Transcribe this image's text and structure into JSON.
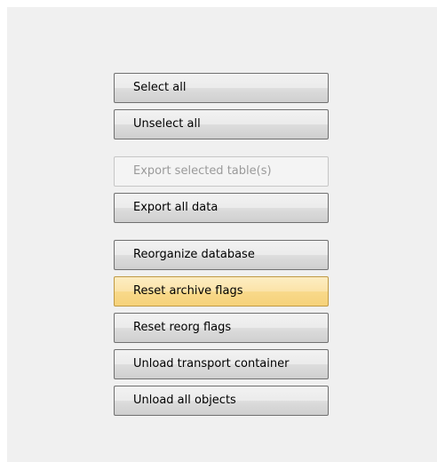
{
  "buttons": {
    "select_all": "Select all",
    "unselect_all": "Unselect all",
    "export_selected": "Export selected table(s)",
    "export_all": "Export all data",
    "reorganize_db": "Reorganize database",
    "reset_archive_flags": "Reset archive flags",
    "reset_reorg_flags": "Reset reorg flags",
    "unload_transport": "Unload transport container",
    "unload_all_objects": "Unload all objects"
  },
  "states": {
    "export_selected_enabled": false,
    "reset_archive_flags_hovered": true
  }
}
